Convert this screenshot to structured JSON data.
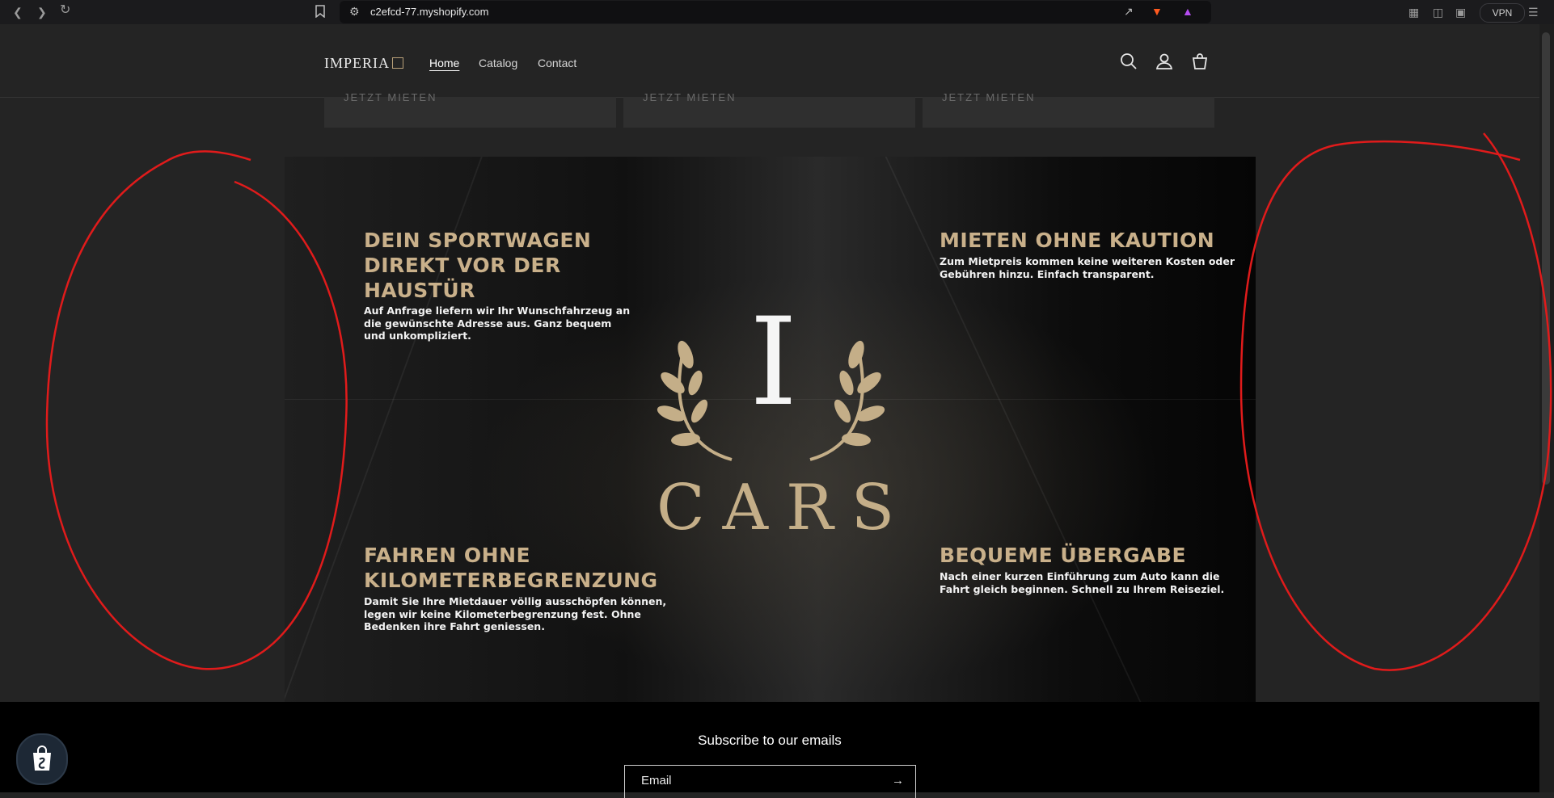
{
  "browser": {
    "url": "c2efcd-77.myshopify.com",
    "vpn_label": "VPN"
  },
  "header": {
    "logo_text": "IMPERIA",
    "nav": [
      {
        "label": "Home",
        "active": true
      },
      {
        "label": "Catalog",
        "active": false
      },
      {
        "label": "Contact",
        "active": false
      }
    ]
  },
  "cards": {
    "cta_label": "JETZT MIETEN"
  },
  "banner": {
    "brand_letter": "I",
    "brand_name": "CARS",
    "features": [
      {
        "title": "DEIN SPORTWAGEN DIREKT VOR DER HAUSTÜR",
        "text": "Auf Anfrage liefern wir Ihr Wunschfahrzeug an die gewünschte Adresse aus. Ganz bequem und unkompliziert."
      },
      {
        "title": "MIETEN OHNE KAUTION",
        "text": "Zum Mietpreis kommen keine weiteren Kosten oder Gebühren hinzu. Einfach transparent."
      },
      {
        "title": "FAHREN OHNE KILOMETERBEGRENZUNG",
        "text": "Damit Sie Ihre Mietdauer völlig ausschöpfen können, legen wir keine Kilometerbegrenzung fest. Ohne Bedenken ihre Fahrt geniessen."
      },
      {
        "title": "BEQUEME ÜBERGABE",
        "text": "Nach einer kurzen Einführung zum Auto kann die Fahrt gleich beginnen. Schnell zu Ihrem Reiseziel."
      }
    ]
  },
  "footer": {
    "subscribe_title": "Subscribe to our emails",
    "email_placeholder": "Email"
  },
  "colors": {
    "accent_gold": "#c9b08a",
    "annotation_red": "#e01b1b"
  }
}
